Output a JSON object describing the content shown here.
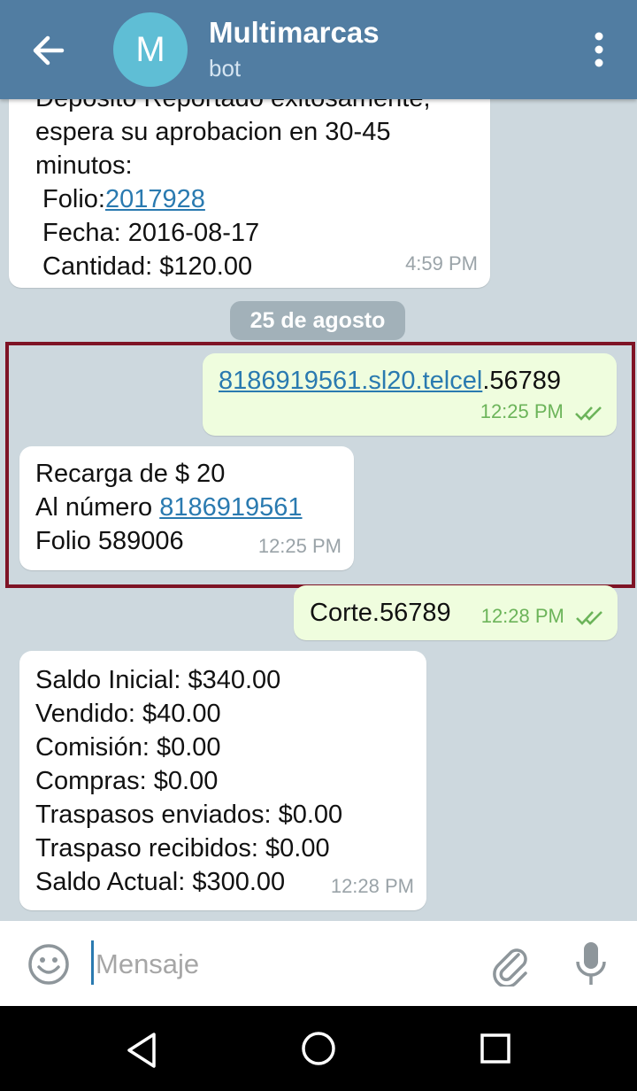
{
  "header": {
    "avatar_letter": "M",
    "title": "Multimarcas",
    "subtitle": "bot",
    "back_icon": "arrow-left-icon",
    "menu_icon": "more-vertical-icon"
  },
  "messages": {
    "m1": {
      "partial_line": "Depósito Reportado exitosamente,",
      "line2": "espera su aprobacion en 30-45",
      "line3": "minutos:",
      "folio_label": " Folio:",
      "folio_value": "2017928",
      "fecha": " Fecha: 2016-08-17",
      "cantidad": " Cantidad: $120.00",
      "time": "4:59 PM"
    },
    "date_separator": "25 de agosto",
    "m2": {
      "link_text": "8186919561.sl20.telcel",
      "rest": ".56789",
      "time": "12:25 PM"
    },
    "m3": {
      "line1": "Recarga de $ 20",
      "line2_label": "Al número ",
      "line2_link": "8186919561",
      "line3": "Folio 589006",
      "time": "12:25 PM"
    },
    "m4": {
      "text": "Corte.56789",
      "time": "12:28 PM"
    },
    "m5": {
      "lines": [
        "Saldo Inicial: $340.00",
        "Vendido: $40.00",
        "Comisión: $0.00",
        "Compras: $0.00",
        "Traspasos enviados: $0.00",
        "Traspaso recibidos: $0.00",
        "Saldo Actual: $300.00"
      ],
      "time": "12:28 PM"
    }
  },
  "input": {
    "placeholder": "Mensaje"
  },
  "colors": {
    "header": "#517da2",
    "avatar": "#5fbed5",
    "link": "#2a7ab0",
    "outgoing_bubble": "#effdde",
    "highlight_border": "#7e1325",
    "read_check": "#6cb45a"
  }
}
